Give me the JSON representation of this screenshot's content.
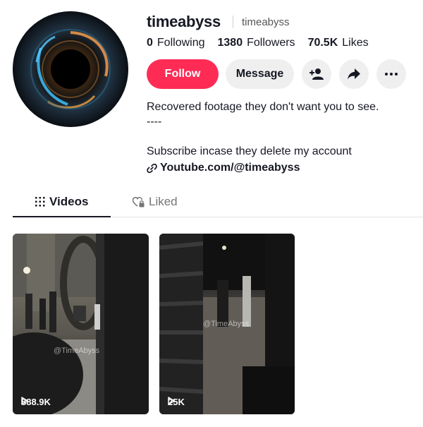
{
  "profile": {
    "username": "timeabyss",
    "nickname": "timeabyss",
    "avatar_icon": "black-hole-avatar"
  },
  "stats": [
    {
      "value": "0",
      "label": "Following"
    },
    {
      "value": "1380",
      "label": "Followers"
    },
    {
      "value": "70.5K",
      "label": "Likes"
    }
  ],
  "actions": {
    "follow_label": "Follow",
    "message_label": "Message",
    "add_friend_icon": "add-friend-icon",
    "share_icon": "share-icon",
    "more_icon": "more-icon"
  },
  "bio": {
    "lines": [
      "Recovered footage they don't want you to see.",
      "----",
      "",
      "Subscribe incase they delete my account"
    ],
    "link": "Youtube.com/@timeabyss"
  },
  "tabs": [
    {
      "label": "Videos",
      "icon": "grid-icon",
      "active": true
    },
    {
      "label": "Liked",
      "icon": "liked-lock-icon",
      "active": false
    }
  ],
  "videos": [
    {
      "views": "888.9K",
      "watermark": "@TimeAbyss"
    },
    {
      "views": "25K",
      "watermark": "@TimeAbyss"
    }
  ],
  "colors": {
    "accent": "#fe2c55",
    "text": "#161823",
    "button_gray": "#efefef"
  }
}
